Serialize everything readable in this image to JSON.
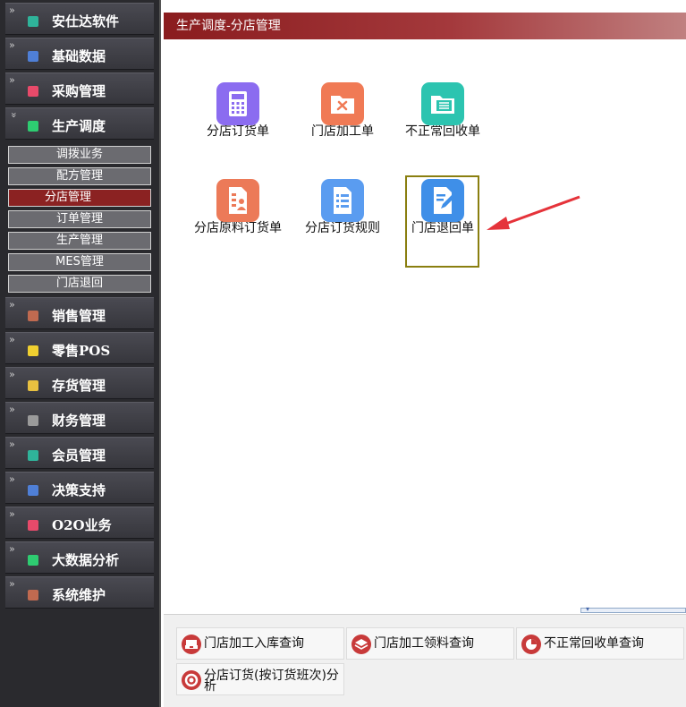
{
  "sidebar": {
    "items": [
      {
        "label": "安仕达软件",
        "icon": "teal-box-icon",
        "color": "#2fb39a"
      },
      {
        "label": "基础数据",
        "icon": "blue-box-icon",
        "color": "#4f7fd6"
      },
      {
        "label": "采购管理",
        "icon": "pink-box-icon",
        "color": "#e84a6a"
      },
      {
        "label": "生产调度",
        "icon": "green-box-icon",
        "color": "#2ecc71",
        "expanded": true
      },
      {
        "label": "销售管理",
        "icon": "brown-box-icon",
        "color": "#c06a50"
      },
      {
        "label": "零售POS",
        "icon": "yellow-box-icon",
        "color": "#f0d030"
      },
      {
        "label": "存货管理",
        "icon": "gold-box-icon",
        "color": "#e8c040"
      },
      {
        "label": "财务管理",
        "icon": "gray-box-icon",
        "color": "#9a9a9a"
      },
      {
        "label": "会员管理",
        "icon": "teal-box-icon",
        "color": "#2fb39a"
      },
      {
        "label": "决策支持",
        "icon": "blue-box-icon",
        "color": "#4f7fd6"
      },
      {
        "label": "O2O业务",
        "icon": "pink-box-icon",
        "color": "#e84a6a"
      },
      {
        "label": "大数据分析",
        "icon": "green-box-icon",
        "color": "#2ecc71"
      },
      {
        "label": "系统维护",
        "icon": "brown-box-icon",
        "color": "#c06a50"
      }
    ],
    "chevron_collapsed": "»",
    "chevron_expanded": "»",
    "submenu": [
      "调拨业务",
      "配方管理",
      "分店管理",
      "订单管理",
      "生产管理",
      "MES管理",
      "门店退回"
    ],
    "submenu_active": "分店管理"
  },
  "header": {
    "title": "生产调度-分店管理"
  },
  "tiles": [
    {
      "label": "分店订货单",
      "icon": "calculator-icon",
      "color": "#8b6cf0"
    },
    {
      "label": "门店加工单",
      "icon": "tools-folder-icon",
      "color": "#f07a55"
    },
    {
      "label": "不正常回收单",
      "icon": "folder-list-icon",
      "color": "#2cc4b0"
    },
    {
      "label": "分店原料订货单",
      "icon": "user-document-icon",
      "color": "#ec7a58"
    },
    {
      "label": "分店订货规则",
      "icon": "checklist-icon",
      "color": "#5a9cf0"
    },
    {
      "label": "门店退回单",
      "icon": "edit-document-icon",
      "color": "#3f8fe8"
    }
  ],
  "quick_links": [
    {
      "label": "门店加工入库查询",
      "icon": "tray-icon",
      "color": "#c83a3a"
    },
    {
      "label": "门店加工领料查询",
      "icon": "layers-icon",
      "color": "#c83a3a"
    },
    {
      "label": "不正常回收单查询",
      "icon": "pie-chart-icon",
      "color": "#c83a3a"
    },
    {
      "label": "分店订货(按订货班次)分析",
      "icon": "lifebuoy-icon",
      "color": "#c83a3a"
    }
  ],
  "annotation": {
    "highlight_color": "#8a7f10",
    "arrow_color": "#e5333a"
  }
}
